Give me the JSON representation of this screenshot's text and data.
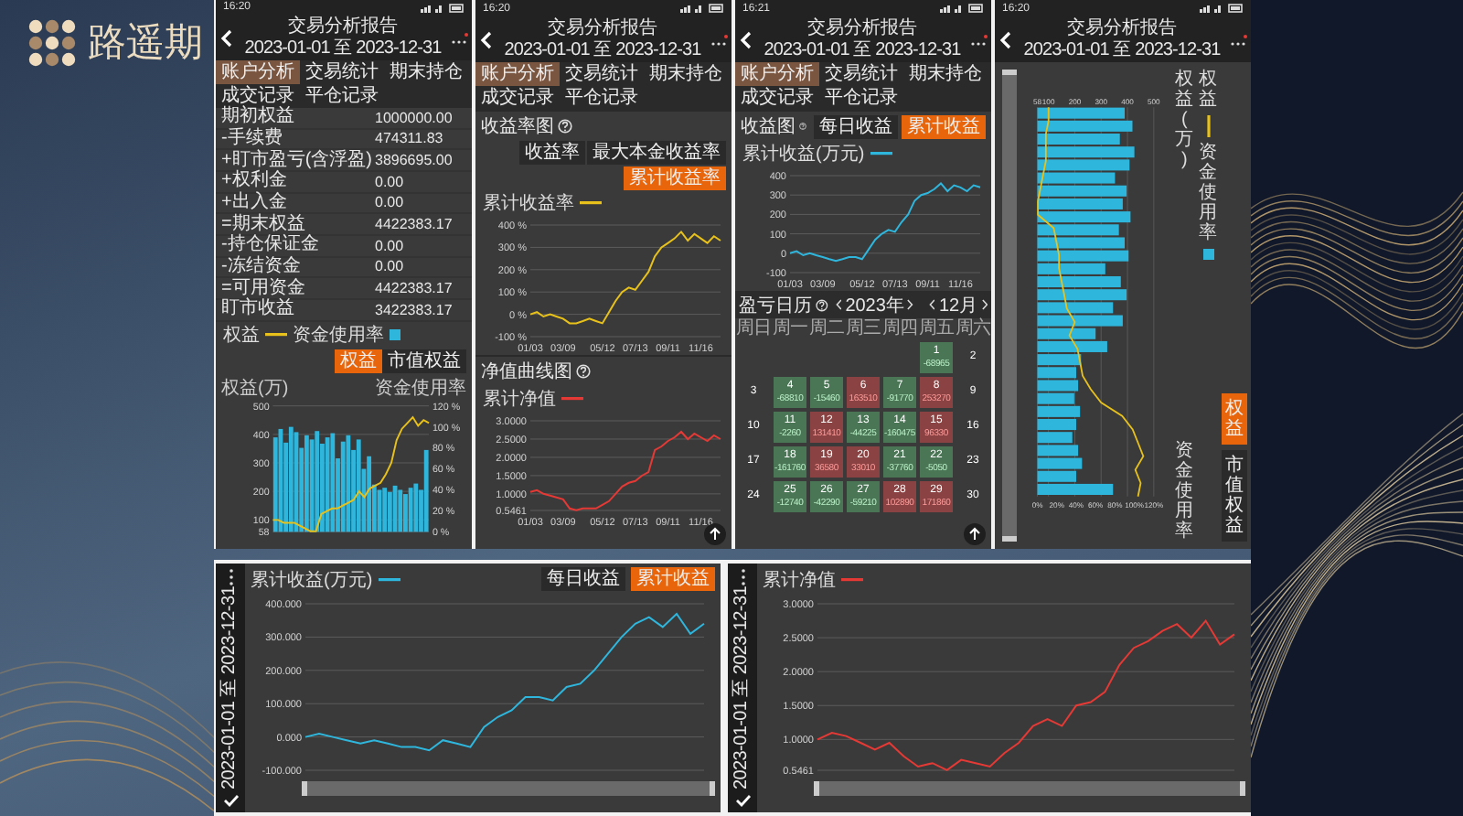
{
  "brand": {
    "name": "路遥期"
  },
  "phones": [
    {
      "kind": "account",
      "status_time": "16:20",
      "title": "交易分析报告",
      "date_range": "2023-01-01 至 2023-12-31",
      "tabs": [
        {
          "label": "账户分析",
          "selected": true
        },
        {
          "label": "交易统计",
          "selected": false
        },
        {
          "label": "期末持仓",
          "selected": false
        },
        {
          "label": "成交记录",
          "selected": false
        },
        {
          "label": "平仓记录",
          "selected": false
        }
      ],
      "rows": [
        {
          "label": "期初权益",
          "value": "1000000.00"
        },
        {
          "label": "-手续费",
          "value": "474311.83"
        },
        {
          "label": "+盯市盈亏(含浮盈)",
          "value": "3896695.00"
        },
        {
          "label": "+权利金",
          "value": "0.00"
        },
        {
          "label": "+出入金",
          "value": "0.00"
        },
        {
          "label": "=期末权益",
          "value": "4422383.17"
        },
        {
          "label": "-持仓保证金",
          "value": "0.00"
        },
        {
          "label": "-冻结资金",
          "value": "0.00"
        },
        {
          "label": "=可用资金",
          "value": "4422383.17"
        },
        {
          "label": "盯市收益",
          "value": "3422383.17"
        }
      ],
      "toggle": [
        {
          "label": "权益",
          "selected": true
        },
        {
          "label": "市值权益",
          "selected": false
        }
      ],
      "chart_data": {
        "type": "bar",
        "grid": true,
        "ylabel": "权益(万)",
        "y2label": "资金使用率",
        "ylim": [
          58,
          500
        ],
        "y2lim": [
          0,
          120
        ],
        "yticks": [
          {
            "value": 58,
            "label": "58"
          },
          {
            "value": 100,
            "label": "100"
          },
          {
            "value": 200,
            "label": "200"
          },
          {
            "value": 300,
            "label": "300"
          },
          {
            "value": 400,
            "label": "400"
          },
          {
            "value": 500,
            "label": "500"
          }
        ],
        "categories": [
          null,
          null,
          null,
          null,
          null,
          null,
          null,
          null,
          null,
          null,
          null,
          null,
          null,
          null,
          null,
          null,
          null,
          null,
          null,
          null,
          null,
          null,
          null,
          null,
          null,
          null,
          null,
          null,
          null,
          null
        ],
        "y2ticks": [
          {
            "value": 0,
            "label": "0 %"
          },
          {
            "value": 20,
            "label": "20 %"
          },
          {
            "value": 40,
            "label": "40 %"
          },
          {
            "value": 60,
            "label": "60 %"
          },
          {
            "value": 80,
            "label": "80 %"
          },
          {
            "value": 100,
            "label": "100 %"
          },
          {
            "value": 120,
            "label": "120 %"
          }
        ],
        "series": [
          {
            "name": "权益",
            "type": "line",
            "color": "#e8c21a",
            "values": [
              100,
              100,
              90,
              90,
              90,
              80,
              70,
              60,
              60,
              120,
              130,
              140,
              140,
              150,
              160,
              170,
              200,
              180,
              210,
              220,
              230,
              260,
              300,
              380,
              420,
              440,
              460,
              430,
              450,
              440
            ]
          },
          {
            "name": "资金使用率",
            "type": "bar",
            "axis": "y2",
            "color": "#2fb6dd",
            "values": [
              90,
              98,
              85,
              100,
              95,
              80,
              92,
              88,
              96,
              84,
              90,
              94,
              70,
              86,
              92,
              78,
              88,
              60,
              72,
              45,
              40,
              42,
              38,
              44,
              40,
              36,
              42,
              46,
              40,
              78
            ]
          }
        ]
      }
    },
    {
      "kind": "returns",
      "status_time": "16:20",
      "title": "交易分析报告",
      "date_range": "2023-01-01 至 2023-12-31",
      "tabs": [
        {
          "label": "账户分析",
          "selected": true
        },
        {
          "label": "交易统计",
          "selected": false
        },
        {
          "label": "期末持仓",
          "selected": false
        },
        {
          "label": "成交记录",
          "selected": false
        },
        {
          "label": "平仓记录",
          "selected": false
        }
      ],
      "sections": [
        {
          "title": "收益率图",
          "toggle": [
            {
              "label": "收益率",
              "selected": false
            },
            {
              "label": "最大本金收益率",
              "selected": false
            },
            {
              "label": "累计收益率",
              "selected": true
            }
          ],
          "chart_data": {
            "type": "line",
            "grid": true,
            "ylim": [
              -100,
              400
            ],
            "yticks": [
              {
                "value": -100,
                "label": "-100 %"
              },
              {
                "value": 0,
                "label": "0 %"
              },
              {
                "value": 100,
                "label": "100 %"
              },
              {
                "value": 200,
                "label": "200 %"
              },
              {
                "value": 300,
                "label": "300 %"
              },
              {
                "value": 400,
                "label": "400 %"
              }
            ],
            "categories": [
              "01/03",
              null,
              null,
              null,
              null,
              "03/09",
              null,
              null,
              null,
              null,
              null,
              "05/12",
              null,
              null,
              null,
              null,
              "07/13",
              null,
              null,
              null,
              null,
              "09/11",
              null,
              null,
              null,
              null,
              "11/16",
              null,
              null,
              null
            ],
            "series": [
              {
                "name": "累计收益率",
                "color": "#e8c21a",
                "values": [
                  0,
                  10,
                  -10,
                  0,
                  -10,
                  -20,
                  -40,
                  -40,
                  -30,
                  -20,
                  -30,
                  -40,
                  10,
                  60,
                  100,
                  120,
                  110,
                  150,
                  190,
                  260,
                  300,
                  320,
                  340,
                  370,
                  330,
                  360,
                  340,
                  320,
                  350,
                  330
                ]
              }
            ]
          }
        },
        {
          "title": "净值曲线图",
          "chart_data": {
            "type": "line",
            "grid": true,
            "ylim": [
              0.5461,
              3
            ],
            "yticks": [
              {
                "value": 0.5461,
                "label": "0.5461"
              },
              {
                "value": 1,
                "label": "1.0000"
              },
              {
                "value": 1.5,
                "label": "1.5000"
              },
              {
                "value": 2,
                "label": "2.0000"
              },
              {
                "value": 2.5,
                "label": "2.5000"
              },
              {
                "value": 3,
                "label": "3.0000"
              }
            ],
            "categories": [
              "01/03",
              null,
              null,
              null,
              null,
              "03/09",
              null,
              null,
              null,
              null,
              null,
              "05/12",
              null,
              null,
              null,
              null,
              "07/13",
              null,
              null,
              null,
              null,
              "09/11",
              null,
              null,
              null,
              null,
              "11/16",
              null,
              null,
              null
            ],
            "series": [
              {
                "name": "累计净值",
                "color": "#e53935",
                "values": [
                  1.05,
                  1.1,
                  1.0,
                  0.95,
                  0.9,
                  0.85,
                  0.6,
                  0.55,
                  0.6,
                  0.6,
                  0.6,
                  0.7,
                  0.8,
                  1.0,
                  1.2,
                  1.3,
                  1.35,
                  1.5,
                  1.6,
                  2.2,
                  2.3,
                  2.45,
                  2.55,
                  2.7,
                  2.5,
                  2.65,
                  2.55,
                  2.45,
                  2.6,
                  2.5
                ]
              }
            ]
          }
        }
      ],
      "scroll_top_button": true
    },
    {
      "kind": "calendar",
      "status_time": "16:21",
      "title": "交易分析报告",
      "date_range": "2023-01-01 至 2023-12-31",
      "tabs": [
        {
          "label": "账户分析",
          "selected": true
        },
        {
          "label": "交易统计",
          "selected": false
        },
        {
          "label": "期末持仓",
          "selected": false
        },
        {
          "label": "成交记录",
          "selected": false
        },
        {
          "label": "平仓记录",
          "selected": false
        }
      ],
      "section_title": "收益图",
      "toggle": [
        {
          "label": "每日收益",
          "selected": false
        },
        {
          "label": "累计收益",
          "selected": true
        }
      ],
      "chart_data": {
        "type": "line",
        "grid": true,
        "ylim": [
          -100,
          400
        ],
        "yticks": [
          -100,
          0,
          100,
          200,
          300,
          400
        ],
        "categories": [
          "01/03",
          null,
          null,
          null,
          null,
          "03/09",
          null,
          null,
          null,
          null,
          null,
          "05/12",
          null,
          null,
          null,
          null,
          "07/13",
          null,
          null,
          null,
          null,
          "09/11",
          null,
          null,
          null,
          null,
          "11/16",
          null,
          null,
          null
        ],
        "series": [
          {
            "name": "累计收益(万元)",
            "color": "#2fb6dd",
            "values": [
              0,
              10,
              -10,
              0,
              -10,
              -20,
              -30,
              -40,
              -30,
              -20,
              -20,
              -30,
              20,
              70,
              100,
              120,
              110,
              160,
              200,
              270,
              300,
              310,
              330,
              360,
              320,
              350,
              340,
              320,
              350,
              340
            ]
          }
        ]
      },
      "calendar": {
        "title": "盈亏日历",
        "year": "2023年",
        "month": "12月",
        "weekdays": [
          "周日",
          "周一",
          "周二",
          "周三",
          "周四",
          "周五",
          "周六"
        ],
        "weeks": [
          [
            {
              "kind": "blank"
            },
            {
              "kind": "blank"
            },
            {
              "kind": "blank"
            },
            {
              "kind": "blank"
            },
            {
              "kind": "blank"
            },
            {
              "kind": "loss",
              "day": "1",
              "value": "-68965"
            },
            {
              "kind": "plain",
              "day": "2"
            }
          ],
          [
            {
              "kind": "plain",
              "day": "3"
            },
            {
              "kind": "loss",
              "day": "4",
              "value": "-68810"
            },
            {
              "kind": "loss",
              "day": "5",
              "value": "-15460"
            },
            {
              "kind": "gain",
              "day": "6",
              "value": "163510"
            },
            {
              "kind": "loss",
              "day": "7",
              "value": "-91770"
            },
            {
              "kind": "gain",
              "day": "8",
              "value": "253270"
            },
            {
              "kind": "plain",
              "day": "9"
            }
          ],
          [
            {
              "kind": "plain",
              "day": "10"
            },
            {
              "kind": "loss",
              "day": "11",
              "value": "-2260"
            },
            {
              "kind": "gain",
              "day": "12",
              "value": "131410"
            },
            {
              "kind": "loss",
              "day": "13",
              "value": "-44225"
            },
            {
              "kind": "loss",
              "day": "14",
              "value": "-160475"
            },
            {
              "kind": "gain",
              "day": "15",
              "value": "96330"
            },
            {
              "kind": "plain",
              "day": "16"
            }
          ],
          [
            {
              "kind": "plain",
              "day": "17"
            },
            {
              "kind": "loss",
              "day": "18",
              "value": "-161760"
            },
            {
              "kind": "gain",
              "day": "19",
              "value": "36580"
            },
            {
              "kind": "gain",
              "day": "20",
              "value": "33010"
            },
            {
              "kind": "loss",
              "day": "21",
              "value": "-37760"
            },
            {
              "kind": "loss",
              "day": "22",
              "value": "-5050"
            },
            {
              "kind": "plain",
              "day": "23"
            }
          ],
          [
            {
              "kind": "plain",
              "day": "24"
            },
            {
              "kind": "loss",
              "day": "25",
              "value": "-12740"
            },
            {
              "kind": "loss",
              "day": "26",
              "value": "-42290"
            },
            {
              "kind": "loss",
              "day": "27",
              "value": "-59210"
            },
            {
              "kind": "gain",
              "day": "28",
              "value": "102890"
            },
            {
              "kind": "gain",
              "day": "29",
              "value": "171860"
            },
            {
              "kind": "plain",
              "day": "30"
            }
          ]
        ]
      },
      "scroll_top_button": true
    },
    {
      "kind": "rotated",
      "status_time": "16:20",
      "title": "交易分析报告",
      "date_range": "2023-01-01 至 2023-12-31",
      "slider": {
        "level": 1
      },
      "toggle": [
        {
          "label": "权益",
          "selected": true
        },
        {
          "label": "市值权益",
          "selected": false
        }
      ],
      "chart_data": {
        "type": "bar",
        "grid": true,
        "orientation": "horizontal",
        "xlabel": "资金使用率",
        "x2label": "权益(万)",
        "xlim": [
          0,
          120
        ],
        "x2lim": [
          58,
          500
        ],
        "xticks": [
          {
            "value": 0,
            "label": "0%"
          },
          {
            "value": 20,
            "label": "20%"
          },
          {
            "value": 40,
            "label": "40%"
          },
          {
            "value": 60,
            "label": "60%"
          },
          {
            "value": 80,
            "label": "80%"
          },
          {
            "value": 100,
            "label": "100%"
          },
          {
            "value": 120,
            "label": "120%"
          }
        ],
        "x2ticks": [
          {
            "value": 58,
            "label": "58"
          },
          {
            "value": 100,
            "label": "100"
          },
          {
            "value": 200,
            "label": "200"
          },
          {
            "value": 300,
            "label": "300"
          },
          {
            "value": 400,
            "label": "400"
          },
          {
            "value": 500,
            "label": "500"
          }
        ],
        "categories": [
          null,
          null,
          null,
          null,
          null,
          null,
          null,
          null,
          null,
          null,
          null,
          null,
          null,
          null,
          null,
          null,
          null,
          null,
          null,
          null,
          null,
          null,
          null,
          null,
          null,
          null,
          null,
          null,
          null,
          null
        ],
        "series": [
          {
            "name": "权益",
            "type": "line",
            "axis": "x2",
            "color": "#e8c21a",
            "values": [
              100,
              100,
              90,
              90,
              90,
              80,
              70,
              60,
              60,
              120,
              130,
              140,
              140,
              150,
              160,
              170,
              200,
              180,
              210,
              220,
              230,
              260,
              300,
              380,
              420,
              440,
              460,
              430,
              450,
              440
            ]
          },
          {
            "name": "资金使用率",
            "type": "bar",
            "color": "#2fb6dd",
            "values": [
              90,
              98,
              85,
              100,
              95,
              80,
              92,
              88,
              96,
              84,
              90,
              94,
              70,
              86,
              92,
              78,
              88,
              60,
              72,
              45,
              40,
              42,
              38,
              44,
              40,
              36,
              42,
              46,
              40,
              78
            ]
          }
        ]
      }
    }
  ],
  "landscapes": [
    {
      "date_range": "2023-01-01 至 2023-12-31",
      "slider": {
        "level": 1
      },
      "toggle": [
        {
          "label": "每日收益",
          "selected": false
        },
        {
          "label": "累计收益",
          "selected": true
        }
      ],
      "chart_data": {
        "type": "line",
        "grid": true,
        "ylim": [
          -100,
          400
        ],
        "yticks": [
          {
            "value": -100,
            "label": "-100.000"
          },
          {
            "value": 0,
            "label": "0.000"
          },
          {
            "value": 100,
            "label": "100.000"
          },
          {
            "value": 200,
            "label": "200.000"
          },
          {
            "value": 300,
            "label": "300.000"
          },
          {
            "value": 400,
            "label": "400.000"
          }
        ],
        "series": [
          {
            "name": "累计收益(万元)",
            "color": "#2fb6dd",
            "values": [
              0,
              10,
              0,
              -10,
              -20,
              -10,
              -20,
              -30,
              -30,
              -40,
              -10,
              -20,
              -30,
              30,
              60,
              80,
              120,
              120,
              110,
              150,
              160,
              200,
              250,
              300,
              340,
              360,
              330,
              370,
              310,
              340
            ]
          }
        ]
      }
    },
    {
      "date_range": "2023-01-01 至 2023-12-31",
      "slider": {
        "level": 1
      },
      "chart_data": {
        "type": "line",
        "grid": true,
        "ylim": [
          0.5461,
          3
        ],
        "yticks": [
          {
            "value": 0.5461,
            "label": "0.5461"
          },
          {
            "value": 1,
            "label": "1.0000"
          },
          {
            "value": 1.5,
            "label": "1.5000"
          },
          {
            "value": 2,
            "label": "2.0000"
          },
          {
            "value": 2.5,
            "label": "2.5000"
          },
          {
            "value": 3,
            "label": "3.0000"
          }
        ],
        "series": [
          {
            "name": "累计净值",
            "color": "#e53935",
            "values": [
              1.0,
              1.1,
              1.05,
              0.95,
              0.85,
              0.95,
              0.75,
              0.6,
              0.65,
              0.55,
              0.7,
              0.65,
              0.6,
              0.8,
              0.95,
              1.2,
              1.3,
              1.2,
              1.5,
              1.55,
              1.7,
              2.1,
              2.35,
              2.45,
              2.6,
              2.7,
              2.5,
              2.75,
              2.4,
              2.55
            ]
          }
        ]
      }
    }
  ]
}
